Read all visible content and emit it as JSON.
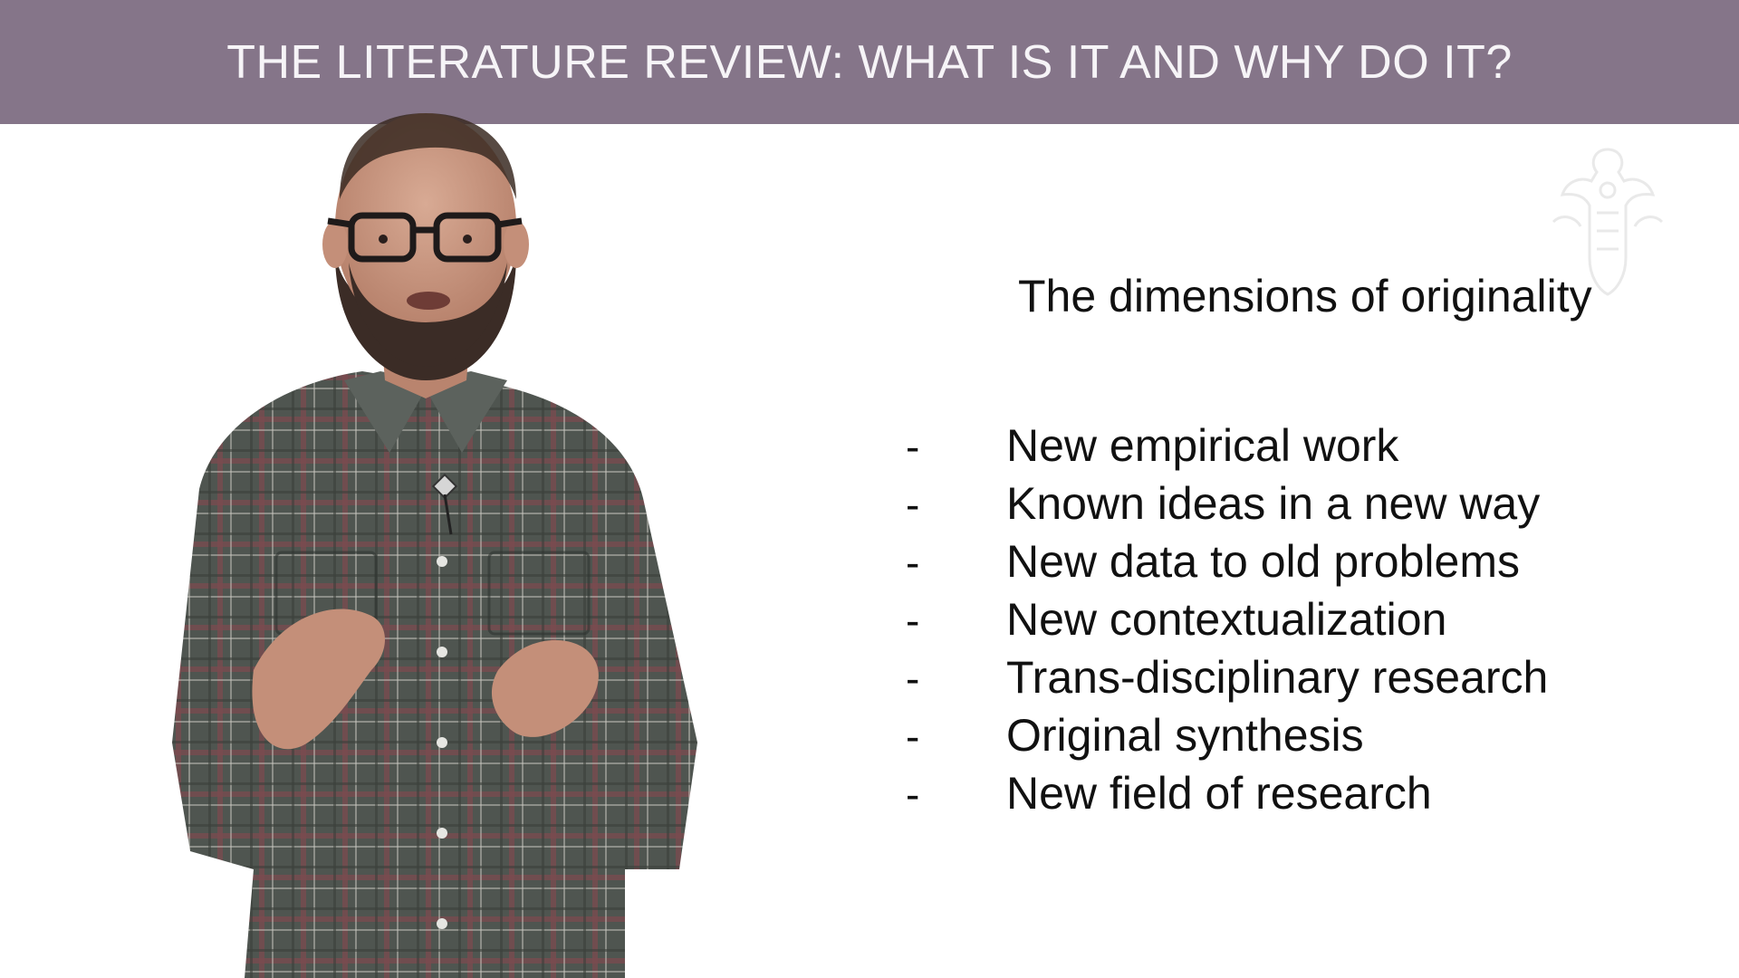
{
  "header": {
    "title": "THE LITERATURE REVIEW: WHAT IS IT AND WHY DO IT?"
  },
  "slide": {
    "subtitle": "The dimensions of originality",
    "bullet_marker": "-",
    "items": [
      "New empirical work",
      "Known ideas in a new way",
      "New data to old problems",
      "New contextualization",
      "Trans-disciplinary research",
      "Original synthesis",
      "New field of research"
    ]
  },
  "colors": {
    "title_bar": "#857589",
    "title_text": "#f6f4f7",
    "body_text": "#111111",
    "background": "#ffffff"
  },
  "icons": {
    "watermark": "university-crest-icon"
  }
}
